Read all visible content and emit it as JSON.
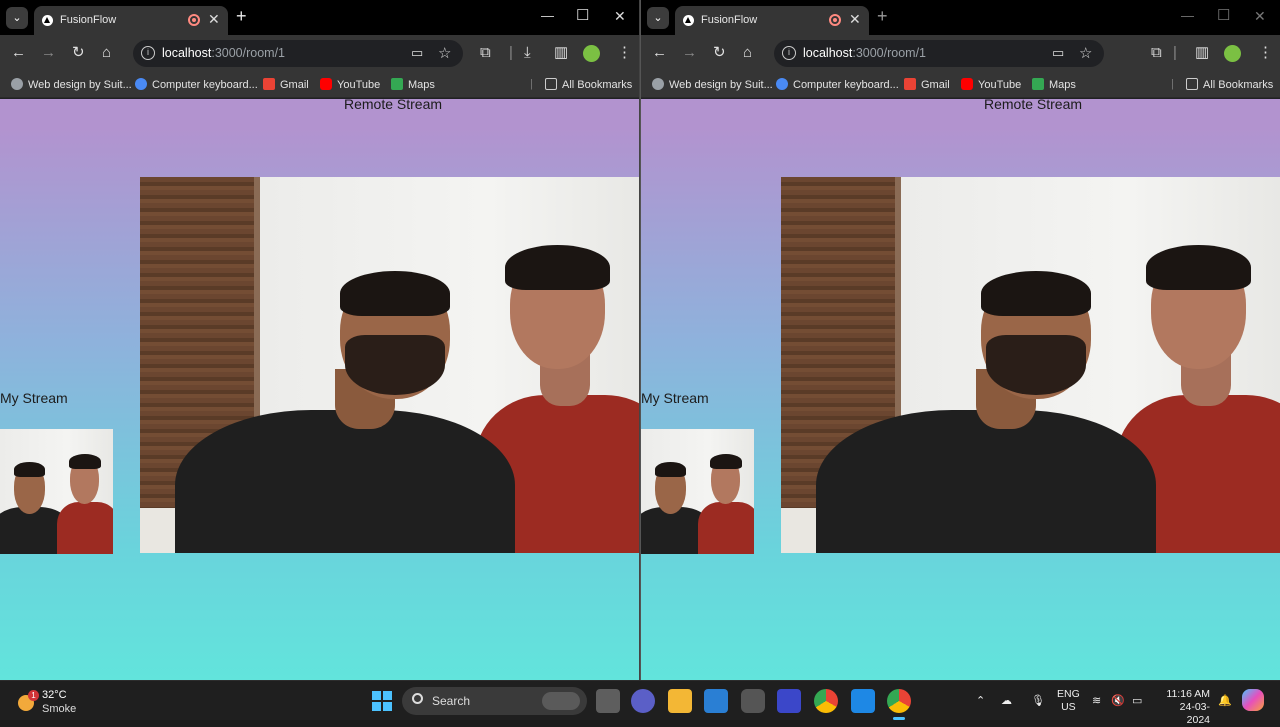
{
  "browser": {
    "tab_title": "FusionFlow",
    "url_host": "localhost",
    "url_path": ":3000/room/1",
    "bookmarks": [
      "Web design by Suit...",
      "Computer keyboard...",
      "Gmail",
      "YouTube",
      "Maps"
    ],
    "all_bookmarks": "All Bookmarks"
  },
  "page": {
    "remote_label": "Remote Stream",
    "my_label": "My Stream"
  },
  "taskbar": {
    "weather_temp": "32°C",
    "weather_cond": "Smoke",
    "weather_badge": "1",
    "search_label": "Search",
    "lang_line1": "ENG",
    "lang_line2": "US",
    "time": "11:16 AM",
    "date": "24-03-2024"
  },
  "colors": {
    "gradient_top": "#b293cf",
    "gradient_bottom": "#62e4dc",
    "accent": "#4cc2ff"
  }
}
